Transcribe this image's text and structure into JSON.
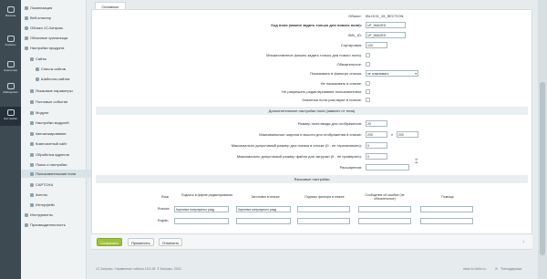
{
  "left_rail": [
    {
      "label": "Магазин"
    },
    {
      "label": "Сервисы"
    },
    {
      "label": "Аналитика"
    },
    {
      "label": "Marketplace"
    },
    {
      "label": "Настройки"
    }
  ],
  "sidebar": {
    "items": [
      {
        "label": "Локализация"
      },
      {
        "label": "Веб-кластер"
      },
      {
        "label": "Облако 1С-Битрикс"
      },
      {
        "label": "Облачные хранилища"
      },
      {
        "label": "Настройки продукта"
      },
      {
        "label": "Сайты"
      },
      {
        "label": "Список сайтов"
      },
      {
        "label": "Шаблоны сайтов"
      },
      {
        "label": "Языковые параметры"
      },
      {
        "label": "Почтовые события"
      },
      {
        "label": "Модули"
      },
      {
        "label": "Настройки модулей"
      },
      {
        "label": "Автокеширование"
      },
      {
        "label": "Композитный сайт"
      },
      {
        "label": "Обработка адресов"
      },
      {
        "label": "Поиск и настройки"
      },
      {
        "label": "Пользовательские поля"
      },
      {
        "label": "CAPTCHA"
      },
      {
        "label": "Агенты"
      },
      {
        "label": "Интерфейс"
      },
      {
        "label": "Инструменты"
      },
      {
        "label": "Производительность"
      }
    ]
  },
  "tab": {
    "label": "Основные"
  },
  "header_row": {
    "label": "Объект:",
    "value": "IBLOCK_15_SECTION"
  },
  "form": {
    "field_code": {
      "label": "Код поля (можно задать только для нового поля):",
      "value": "UF_IMAGES"
    },
    "xml_id": {
      "label": "XML_ID:",
      "value": "UF_IMAGES"
    },
    "sort": {
      "label": "Сортировка:",
      "value": "100"
    },
    "multiple": {
      "label": "Множественное (можно задать только для нового поля):"
    },
    "mandatory": {
      "label": "Обязательное:"
    },
    "show_filter": {
      "label": "Показывать в фильтре списка:",
      "value": "не показывать"
    },
    "not_show_list": {
      "label": "Не показывать в списке:"
    },
    "no_edit": {
      "label": "Не разрешать редактирование пользователем:"
    },
    "search": {
      "label": "Значения поля участвуют в поиске:"
    }
  },
  "extra": {
    "section": "Дополнительные настройки поля (зависят от типа)",
    "input_size": {
      "label": "Размер поля ввода для отображения:",
      "value": "20"
    },
    "max_wh": {
      "label": "Максимальные ширина и высота для отображения в списке:",
      "w": "200",
      "sep": "x",
      "h": "200"
    },
    "max_size_show": {
      "label": "Максимально допустимый размер для показа в списке (0 - не ограничивать):",
      "value": "0"
    },
    "max_size_upload": {
      "label": "Максимально допустимый размер файла для загрузки (0 - не проверять):",
      "value": "0"
    },
    "extensions": {
      "label": "Расширения:",
      "value": ""
    }
  },
  "lang": {
    "section": "Языковые настройки",
    "headers": {
      "lang": "Язык",
      "edit_form": "Подпись в форме редактирования",
      "list_header": "Заголовок в списке",
      "filter_caption": "Подпись фильтра в списке",
      "error": "Сообщение об ошибке (не обязательное)",
      "help": "Помощь"
    },
    "rows": [
      {
        "lang": "Russian",
        "edit_form": "Картинка популярного разд",
        "list_header": "Картинка популярного разд",
        "filter_caption": "",
        "error": "",
        "help": ""
      },
      {
        "lang": "English",
        "edit_form": "",
        "list_header": "",
        "filter_caption": "",
        "error": "",
        "help": ""
      }
    ]
  },
  "buttons": {
    "save": "Сохранить",
    "apply": "Применить",
    "cancel": "Отменить"
  },
  "footer": {
    "copyright": "1С-Битрикс: Управление сайтом 15.5.18. © Битрикс, 2015",
    "site": "www.1c-bitrix.ru",
    "support": "Техподдержка"
  },
  "cursor_glyph": "⌶"
}
